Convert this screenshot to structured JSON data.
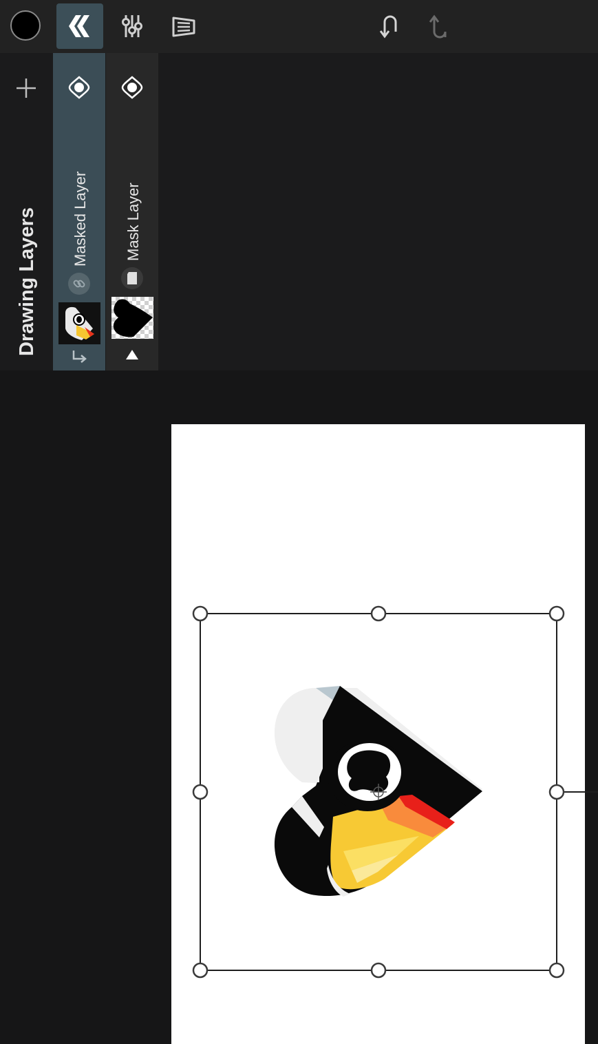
{
  "toolbar": {
    "color": "#000000",
    "buttons": [
      {
        "icon": "layers-icon",
        "active": true
      },
      {
        "icon": "adjustments-icon",
        "active": false
      },
      {
        "icon": "transform-icon",
        "active": false
      },
      {
        "icon": "undo-icon",
        "active": false
      },
      {
        "icon": "redo-icon",
        "active": false
      }
    ]
  },
  "layers_panel": {
    "title": "Drawing Layers",
    "add_icon": "plus-icon",
    "layers": [
      {
        "name": "Masked Layer",
        "selected": true,
        "visibility_icon": "eye-icon",
        "badge_icon": "link-icon",
        "indicator_icon": "clip-arrow-icon"
      },
      {
        "name": "Mask Layer",
        "selected": false,
        "visibility_icon": "eye-icon",
        "badge_icon": "mask-icon",
        "indicator_icon": "triangle-up-icon"
      }
    ]
  },
  "canvas": {
    "background": "#ffffff",
    "artwork": "toucan-heart",
    "transform_box": {
      "handles": 8
    }
  },
  "accent": "#3b4d56"
}
